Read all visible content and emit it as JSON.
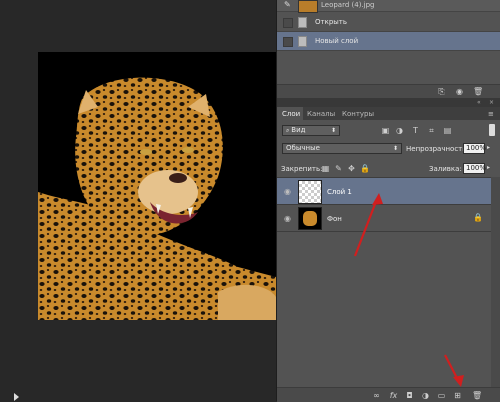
{
  "history": {
    "file_name": "Leopard (4).jpg",
    "items": [
      {
        "label": "Открыть"
      },
      {
        "label": "Новый слой"
      }
    ]
  },
  "layers_panel": {
    "tabs": [
      {
        "label": "Слои"
      },
      {
        "label": "Каналы"
      },
      {
        "label": "Контуры"
      }
    ],
    "filter_label": "Вид",
    "blend_mode": "Обычные",
    "opacity_label": "Непрозрачность:",
    "opacity_value": "100%",
    "lock_label": "Закрепить:",
    "fill_label": "Заливка:",
    "fill_value": "100%",
    "layers": [
      {
        "name": "Слой 1",
        "selected": true
      },
      {
        "name": "Фон",
        "locked": true
      }
    ]
  },
  "colors": {
    "panel": "#535353",
    "selection": "#66748d",
    "arrow": "#d01f1f",
    "canvas_bg": "#282828"
  },
  "icons": [
    "brush-icon",
    "new-snapshot-icon",
    "camera-icon",
    "delete-icon",
    "link-icon",
    "fx-icon",
    "mask-icon",
    "adjustment-icon",
    "folder-icon",
    "new-layer-icon",
    "trash-icon",
    "lock-icon",
    "eye-icon",
    "play-icon"
  ]
}
